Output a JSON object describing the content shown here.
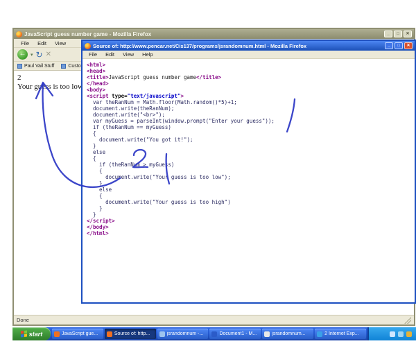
{
  "main_window": {
    "title": "JavaScript guess number game - Mozilla Firefox",
    "menu": [
      "File",
      "Edit",
      "View"
    ],
    "bookmarks": [
      "Paul Vail Stuff",
      "Customize..."
    ],
    "content_line1": "2",
    "content_line2": "Your guess is too low",
    "status": "Done"
  },
  "source_window": {
    "title": "Source of: http://www.pencar.net/Cis137/programs/jsrandomnum.html - Mozilla Firefox",
    "menu": [
      "File",
      "Edit",
      "View",
      "Help"
    ],
    "code_lines": [
      [
        {
          "t": "<html>",
          "c": "tag"
        }
      ],
      [
        {
          "t": "<head>",
          "c": "tag"
        }
      ],
      [
        {
          "t": "<title>",
          "c": "tag"
        },
        {
          "t": "JavaScript guess number game",
          "c": "text"
        },
        {
          "t": "</title>",
          "c": "tag"
        }
      ],
      [
        {
          "t": "</head>",
          "c": "tag"
        }
      ],
      [
        {
          "t": "<body>",
          "c": "tag"
        }
      ],
      [
        {
          "t": "<script ",
          "c": "tag"
        },
        {
          "t": "type=",
          "c": "attr"
        },
        {
          "t": "\"text/javascript\"",
          "c": "val"
        },
        {
          "t": ">",
          "c": "tag"
        }
      ],
      [
        {
          "t": "  var theRanNum = Math.floor(Math.random()*5)+1;",
          "c": "code"
        }
      ],
      [
        {
          "t": "  document.write(theRanNum);",
          "c": "code"
        }
      ],
      [
        {
          "t": "  document.write(\"<br>\");",
          "c": "code"
        }
      ],
      [
        {
          "t": "  var myGuess = parseInt(window.prompt(\"Enter your guess\"));",
          "c": "code"
        }
      ],
      [
        {
          "t": "  if (theRanNum == myGuess)",
          "c": "code"
        }
      ],
      [
        {
          "t": "  {",
          "c": "code"
        }
      ],
      [
        {
          "t": "    document.write(\"You got it!\");",
          "c": "code"
        }
      ],
      [
        {
          "t": "  }",
          "c": "code"
        }
      ],
      [
        {
          "t": "  else",
          "c": "code"
        }
      ],
      [
        {
          "t": "  {",
          "c": "code"
        }
      ],
      [
        {
          "t": "    if (theRanNum > myGuess)",
          "c": "code"
        }
      ],
      [
        {
          "t": "    {",
          "c": "code"
        }
      ],
      [
        {
          "t": "      document.write(\"Your guess is too low\");",
          "c": "code"
        }
      ],
      [
        {
          "t": "    }",
          "c": "code"
        }
      ],
      [
        {
          "t": "    else",
          "c": "code"
        }
      ],
      [
        {
          "t": "    {",
          "c": "code"
        }
      ],
      [
        {
          "t": "      document.write(\"Your guess is too high\")",
          "c": "code"
        }
      ],
      [
        {
          "t": "    }",
          "c": "code"
        }
      ],
      [
        {
          "t": "  }",
          "c": "code"
        }
      ],
      [
        {
          "t": "</script>",
          "c": "tag"
        }
      ],
      [
        {
          "t": "</body>",
          "c": "tag"
        }
      ],
      [
        {
          "t": "</html>",
          "c": "tag"
        }
      ]
    ]
  },
  "taskbar": {
    "start_label": "start",
    "buttons": [
      {
        "label": "JavaScript gue...",
        "icon": "#f07020",
        "active": false
      },
      {
        "label": "Source of: http...",
        "icon": "#f07020",
        "active": true
      },
      {
        "label": "jsrandomnum -...",
        "icon": "#9ec4ee",
        "active": false
      },
      {
        "label": "Document1 - M...",
        "icon": "#2b5bc8",
        "active": false
      },
      {
        "label": "jsrandomnum...",
        "icon": "#e8e8e8",
        "active": false
      },
      {
        "label": "2 Internet Exp...",
        "icon": "#3aa0e8",
        "active": false
      }
    ],
    "tray_icons": [
      {
        "name": "volume-icon",
        "color": "#cfe6ff"
      },
      {
        "name": "network-icon",
        "color": "#9fd4f2"
      },
      {
        "name": "shield-icon",
        "color": "#e4b23a"
      }
    ]
  },
  "colors": {
    "ink": "#2b36c4",
    "active_titlebar": "#1c50b8",
    "inactive_titlebar": "#8c8c6e",
    "taskbar_blue": "#2458cf",
    "start_green": "#2e7d2a"
  }
}
